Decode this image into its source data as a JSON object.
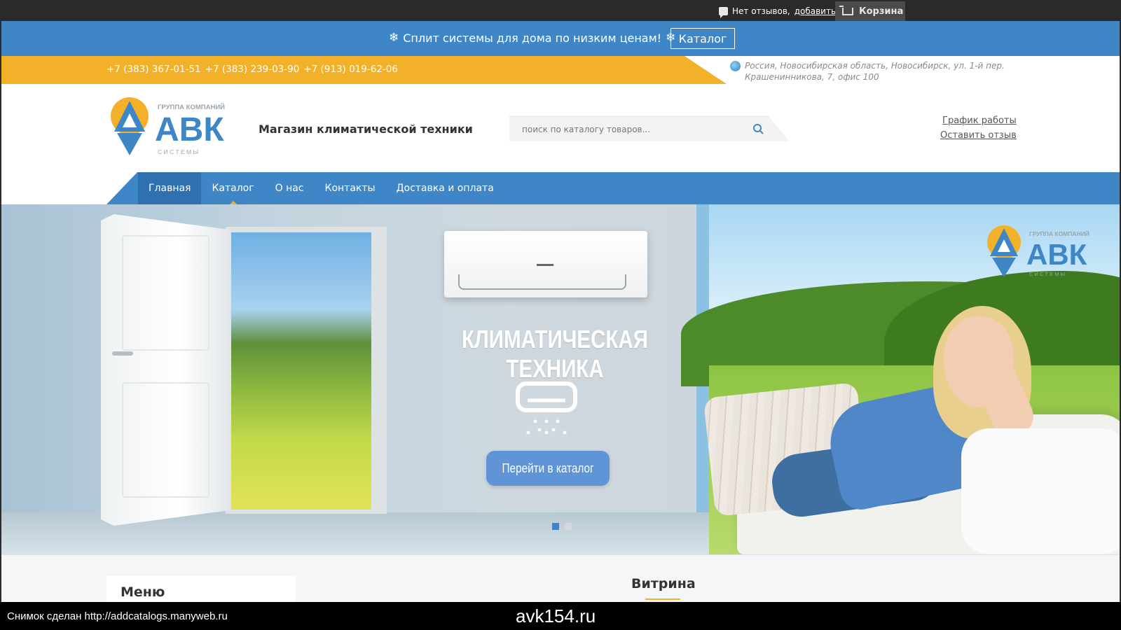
{
  "topbar": {
    "reviews_text": "Нет отзывов,",
    "reviews_link": "добавить",
    "cart_label": "Корзина"
  },
  "promo": {
    "text": "Сплит системы для дома по низким ценам!",
    "button": "Каталог"
  },
  "contacts": {
    "phones": [
      "+7 (383) 367-01-51",
      "+7 (383) 239-03-90",
      "+7 (913) 019-62-06"
    ],
    "address_line1": "Россия, Новосибирская область, Новосибирск, ул. 1-й пер.",
    "address_line2": "Крашенинникова, 7, офис 100"
  },
  "header": {
    "logo": {
      "top_text": "ГРУППА КОМПАНИЙ",
      "main": "АВК",
      "bottom_text": "С И С Т Е М Ы"
    },
    "store_title": "Магазин климатической техники",
    "search_placeholder": "поиск по каталогу товаров...",
    "links": [
      "График работы",
      "Оставить отзыв"
    ]
  },
  "nav": {
    "items": [
      {
        "label": "Главная",
        "active": true
      },
      {
        "label": "Каталог",
        "active": false
      },
      {
        "label": "О нас",
        "active": false
      },
      {
        "label": "Контакты",
        "active": false
      },
      {
        "label": "Доставка и оплата",
        "active": false
      }
    ]
  },
  "hero": {
    "title": "КЛИМАТИЧЕСКАЯ ТЕХНИКА",
    "button": "Перейти в каталог",
    "slides_total": 2,
    "slide_active": 1,
    "logo": {
      "top_text": "ГРУППА КОМПАНИЙ",
      "main": "АВК",
      "bottom_text": "С И С Т Е М Ы"
    }
  },
  "content": {
    "menu_title": "Меню",
    "showcase_title": "Витрина"
  },
  "caption": {
    "left": "Снимок сделан http://addcatalogs.manyweb.ru",
    "center": "avk154.ru"
  },
  "colors": {
    "accent_blue": "#3f86c7",
    "accent_yellow": "#f3b12a",
    "dark_bar": "#2a2a2a"
  }
}
